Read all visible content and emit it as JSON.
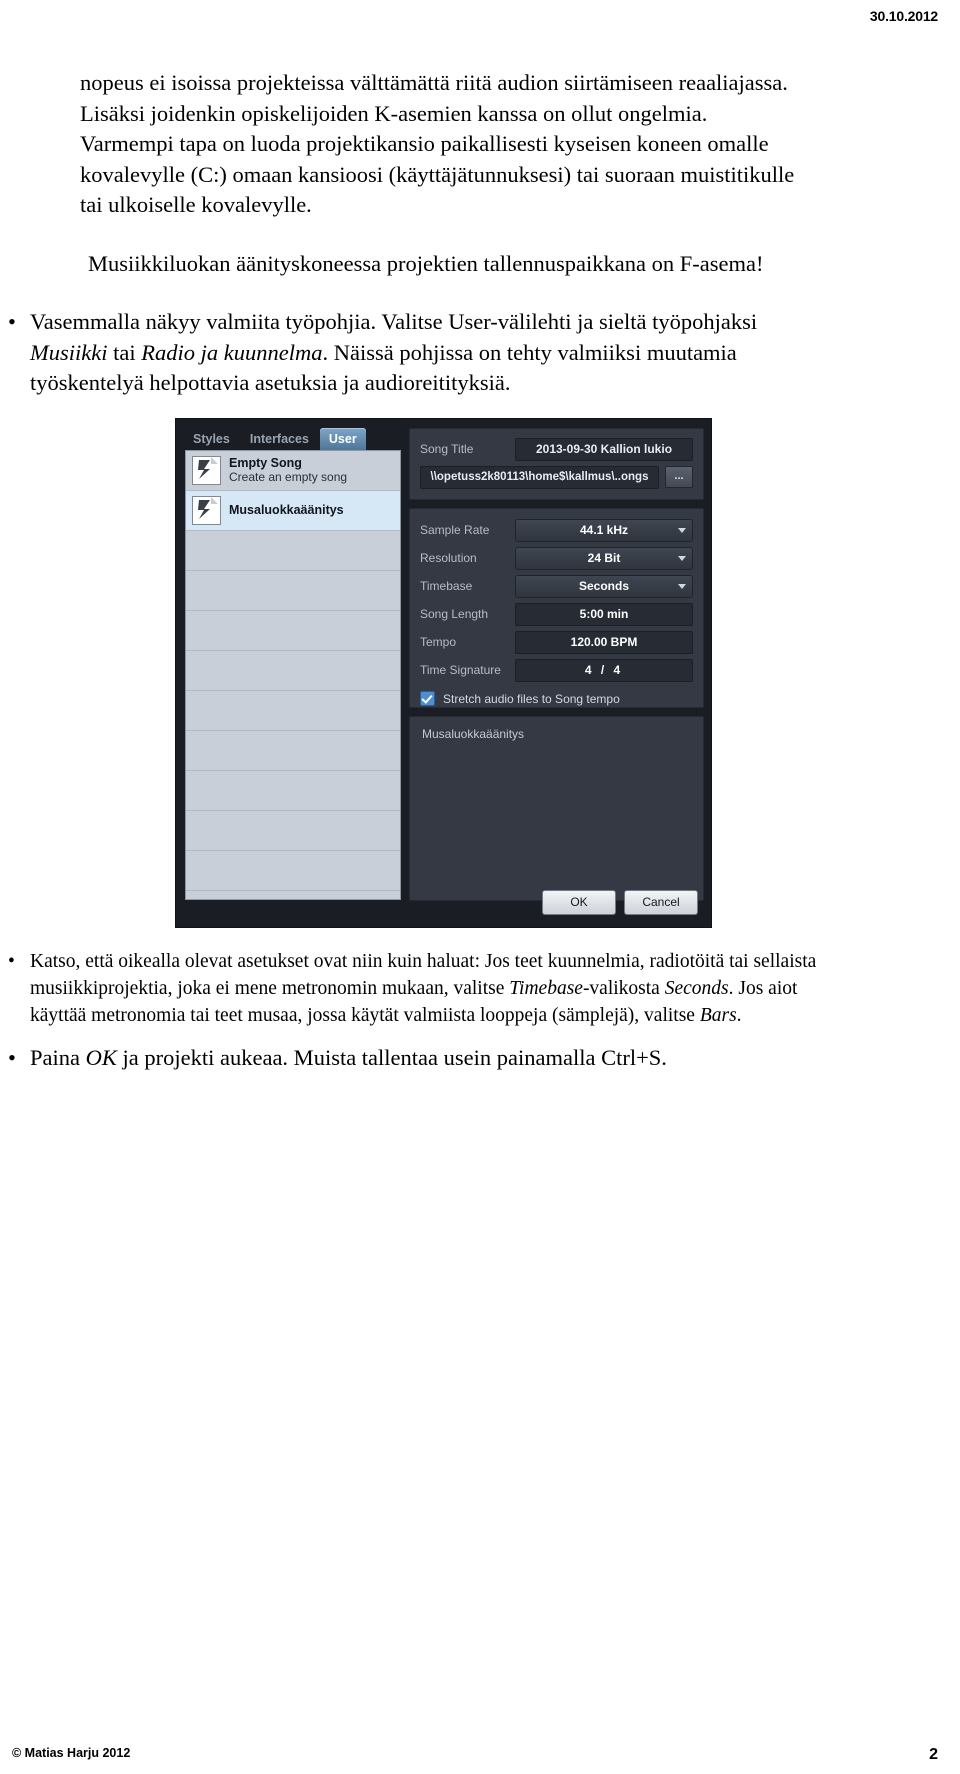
{
  "page": {
    "header_date": "30.10.2012",
    "footer_copyright": "© Matias Harju 2012",
    "page_number": "2"
  },
  "body": {
    "paragraph_1_line_1": "nopeus ei isoissa projekteissa välttämättä riitä audion siirtämiseen reaaliajassa.",
    "paragraph_1_line_2": "Lisäksi joidenkin opiskelijoiden K-asemien kanssa on ollut ongelmia.",
    "paragraph_2_line_1": "Varmempi tapa on luoda projektikansio paikallisesti kyseisen koneen omalle",
    "paragraph_2_line_2": "kovalevylle (C:) omaan kansioosi (käyttäjätunnuksesi) tai suoraan muistitikulle",
    "paragraph_2_line_3": "tai ulkoiselle kovalevylle.",
    "paragraph_3": "Musiikkiluokan äänityskoneessa projektien tallennuspaikkana on F-asema!",
    "bullet_marker": "•",
    "bullet_1": {
      "line_1_a": "Vasemmalla näkyy valmiita työpohjia. Valitse User-välilehti ja sieltä työpohjaksi",
      "line_2_italic_1": "Musiikki",
      "line_2_b": " tai ",
      "line_2_italic_2": "Radio ja kuunnelma",
      "line_2_c": ". Näissä pohjissa on tehty valmiiksi muutamia",
      "line_3": "työskentelyä helpottavia asetuksia ja audioreitityksiä."
    },
    "bullet_2": {
      "line_1": "Katso, että oikealla olevat asetukset ovat niin kuin haluat: Jos teet kuunnelmia, radiotöitä tai sellaista",
      "line_2_a": "musiikkiprojektia, joka ei mene metronomin mukaan, valitse ",
      "line_2_italic_1": "Timebase",
      "line_2_b": "-valikosta ",
      "line_2_italic_2": "Seconds",
      "line_2_c": ". Jos aiot",
      "line_3_a": "käyttää metronomia tai teet musaa, jossa käytät valmiista looppeja (sämplejä), valitse ",
      "line_3_italic": "Bars",
      "line_3_b": "."
    },
    "bullet_3": {
      "text_a": "Paina ",
      "italic": "OK",
      "text_b": " ja projekti aukeaa. Muista tallentaa usein painamalla Ctrl+S."
    }
  },
  "screenshot": {
    "tabs": [
      {
        "label": "Styles",
        "active": false
      },
      {
        "label": "Interfaces",
        "active": false
      },
      {
        "label": "User",
        "active": true
      }
    ],
    "templates": [
      {
        "title": "Empty Song",
        "subtitle": "Create an empty song",
        "selected": "grey"
      },
      {
        "title": "Musaluokkaäänitys",
        "subtitle": "",
        "selected": "blue"
      }
    ],
    "song_title_label": "Song Title",
    "song_title_value": "2013-09-30 Kallion lukio",
    "song_path_value": "\\\\opetuss2k80113\\home$\\kallmus\\..ongs",
    "browse_button_label": "...",
    "settings": [
      {
        "label": "Sample Rate",
        "value": "44.1 kHz",
        "kind": "select"
      },
      {
        "label": "Resolution",
        "value": "24 Bit",
        "kind": "select"
      },
      {
        "label": "Timebase",
        "value": "Seconds",
        "kind": "select"
      },
      {
        "label": "Song Length",
        "value": "5:00 min",
        "kind": "plain"
      },
      {
        "label": "Tempo",
        "value": "120.00 BPM",
        "kind": "plain"
      },
      {
        "label": "Time Signature",
        "value": "4 / 4",
        "kind": "timesig"
      }
    ],
    "stretch_checkbox_label": "Stretch audio files to Song tempo",
    "stretch_checkbox_checked": true,
    "notes_title": "Musaluokkaäänitys",
    "ok_label": "OK",
    "cancel_label": "Cancel",
    "colors": {
      "dialog_bg": "#1a1d24",
      "panel_bg": "#343943",
      "active_tab": "#4d7699",
      "list_selected_blue": "#d6e7f5",
      "checkbox_accent": "#4f8fd0"
    }
  }
}
